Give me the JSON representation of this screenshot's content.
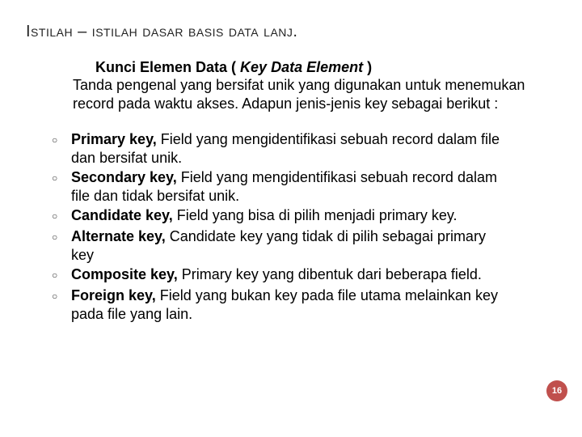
{
  "title": "Istilah – istilah dasar basis data lanj.",
  "intro": {
    "heading_plain": "Kunci Elemen Data ( ",
    "heading_italic": "Key Data Element",
    "heading_close": " )",
    "body": "Tanda pengenal yang bersifat unik yang digunakan untuk menemukan record pada waktu akses. Adapun jenis-jenis key sebagai berikut :"
  },
  "keys": [
    {
      "name": "Primary key,",
      "desc": " Field yang mengidentifikasi sebuah record dalam file dan bersifat unik."
    },
    {
      "name": "Secondary key,",
      "desc": "  Field yang mengidentifikasi sebuah record dalam file dan tidak bersifat unik."
    },
    {
      "name": "Candidate key,",
      "desc": " Field yang bisa di pilih menjadi primary key."
    },
    {
      "name": "Alternate key,",
      "desc": " Candidate key yang tidak di pilih sebagai primary key"
    },
    {
      "name": "Composite key,",
      "desc": " Primary key yang dibentuk dari beberapa field."
    },
    {
      "name": "Foreign key,",
      "desc": " Field yang bukan key pada file utama melainkan key pada file yang lain."
    }
  ],
  "page_number": "16",
  "bullet_glyph": "○"
}
